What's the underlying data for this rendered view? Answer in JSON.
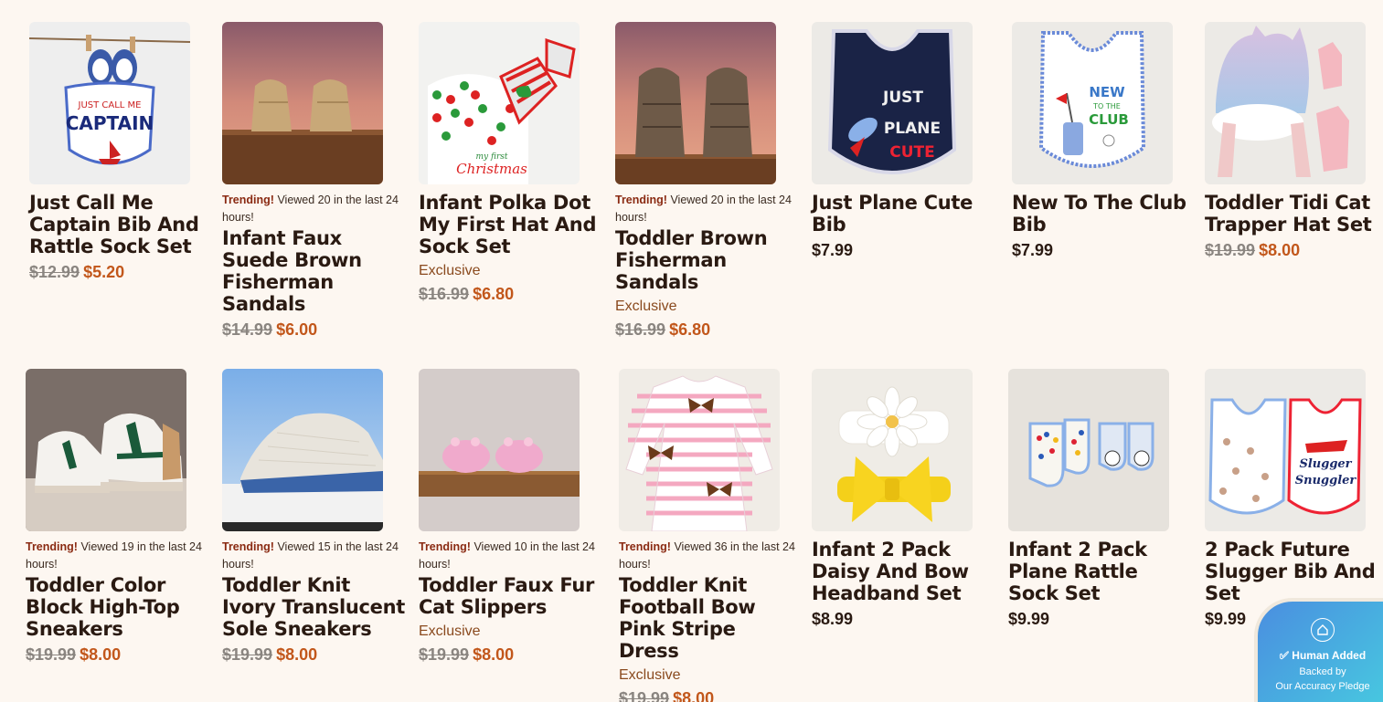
{
  "products": [
    {
      "title": "Just Call Me Captain Bib And Rattle Sock Set",
      "old": "$12.99",
      "price": "$5.20"
    },
    {
      "trend_label": "Trending!",
      "trend_text": "Viewed 20 in the last 24 hours!",
      "title": "Infant Faux Suede Brown Fisherman Sandals",
      "old": "$14.99",
      "price": "$6.00"
    },
    {
      "title": "Infant Polka Dot My First Hat And Sock Set",
      "exclusive": "Exclusive",
      "old": "$16.99",
      "price": "$6.80"
    },
    {
      "trend_label": "Trending!",
      "trend_text": "Viewed 20 in the last 24 hours!",
      "title": "Toddler Brown Fisherman Sandals",
      "exclusive": "Exclusive",
      "old": "$16.99",
      "price": "$6.80"
    },
    {
      "title": "Just Plane Cute Bib",
      "price": "$7.99"
    },
    {
      "title": "New To The Club Bib",
      "price": "$7.99"
    },
    {
      "title": "Toddler Tidi Cat Trapper Hat Set",
      "old": "$19.99",
      "price": "$8.00"
    },
    {
      "trend_label": "Trending!",
      "trend_text": "Viewed 19 in the last 24 hours!",
      "title": "Toddler Color Block High-Top Sneakers",
      "old": "$19.99",
      "price": "$8.00"
    },
    {
      "trend_label": "Trending!",
      "trend_text": "Viewed 15 in the last 24 hours!",
      "title": "Toddler Knit Ivory Translucent Sole Sneakers",
      "old": "$19.99",
      "price": "$8.00"
    },
    {
      "trend_label": "Trending!",
      "trend_text": "Viewed 10 in the last 24 hours!",
      "title": "Toddler Faux Fur Cat Slippers",
      "exclusive": "Exclusive",
      "old": "$19.99",
      "price": "$8.00"
    },
    {
      "trend_label": "Trending!",
      "trend_text": "Viewed 36 in the last 24 hours!",
      "title": "Toddler Knit Football Bow Pink Stripe Dress",
      "exclusive": "Exclusive",
      "old": "$19.99",
      "price": "$8.00"
    },
    {
      "title": "Infant 2 Pack Daisy And Bow Headband Set",
      "price": "$8.99"
    },
    {
      "title": "Infant 2 Pack Plane Rattle Sock Set",
      "price": "$9.99"
    },
    {
      "title": "2 Pack Future Slugger Bib And Set",
      "price": "$9.99"
    }
  ],
  "image_text": {
    "captain": [
      "JUST CALL ME",
      "CAPTAIN"
    ],
    "christmas": [
      "my first",
      "Christmas"
    ],
    "plane": [
      "JUST",
      "PLANE",
      "CUTE"
    ],
    "club": [
      "NEW",
      "TO THE",
      "CLUB"
    ],
    "slugger": [
      "Slugger",
      "Snuggler"
    ]
  },
  "badge": {
    "title": "Human Added",
    "line1": "Backed by",
    "line2": "Our Accuracy Pledge",
    "icon": "home-icon"
  },
  "colors": {
    "background": "#fdf7f1",
    "sale_price": "#c2571b",
    "trending": "#8a2a12",
    "exclusive": "#8a4a1e",
    "badge": "#4a8ee0"
  }
}
